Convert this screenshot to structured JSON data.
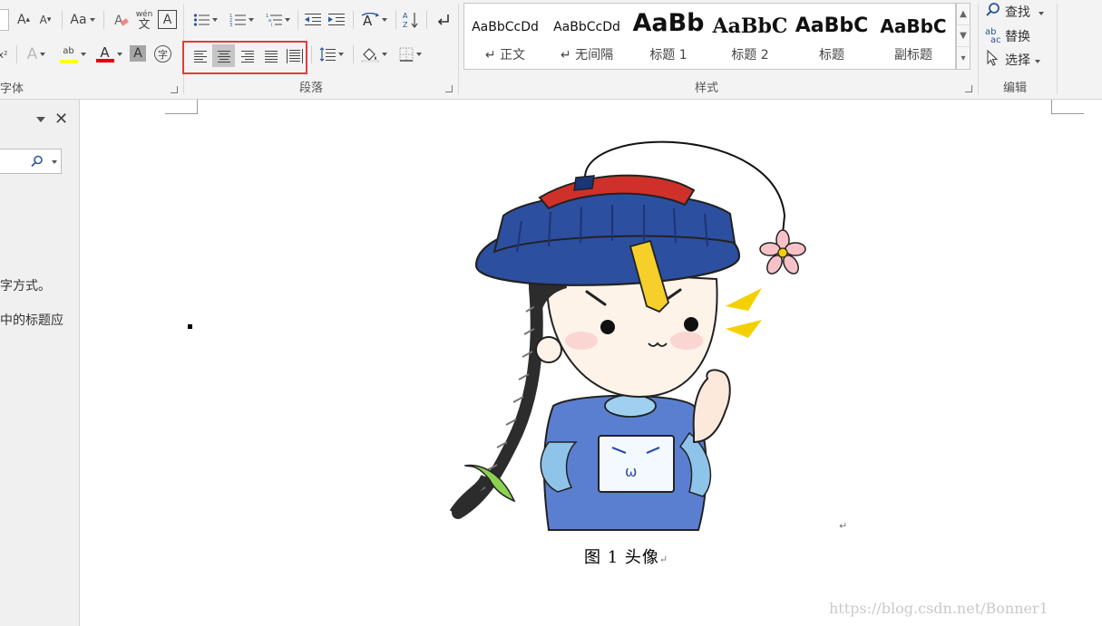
{
  "font_group": {
    "label": "字体",
    "grow_font": "A",
    "shrink_font": "A",
    "change_case": "Aa",
    "phonetic_top": "wén",
    "phonetic_bottom": "文",
    "char_border": "A",
    "superscript": "x²",
    "text_effects": "A",
    "highlight": "ab",
    "font_color": "A",
    "char_shading": "A",
    "enclose": "字"
  },
  "paragraph_group": {
    "label": "段落"
  },
  "styles_group": {
    "label": "样式",
    "items": [
      {
        "sample": "AaBbCcDd",
        "name": "↵ 正文"
      },
      {
        "sample": "AaBbCcDd",
        "name": "↵ 无间隔"
      },
      {
        "sample": "AaBb",
        "name": "标题 1"
      },
      {
        "sample": "AaBbC",
        "name": "标题 2"
      },
      {
        "sample": "AaBbC",
        "name": "标题"
      },
      {
        "sample": "AaBbC",
        "name": "副标题"
      }
    ]
  },
  "editing_group": {
    "label": "编辑",
    "find": "查找",
    "replace": "替换",
    "select": "选择",
    "replace_icon_top": "ab",
    "replace_icon_bottom": "ac"
  },
  "nav_pane": {
    "line1": "字方式。",
    "line2": "中的标题应"
  },
  "document": {
    "caption": "图  1  头像",
    "paragraph_mark": "↵",
    "watermark": "https://blog.csdn.net/Bonner1"
  },
  "colors": {
    "highlight_box": "#e03c3c",
    "hat_blue": "#2d4fa0",
    "robe_blue": "#5b7fd0",
    "brim_red": "#d0302a"
  }
}
